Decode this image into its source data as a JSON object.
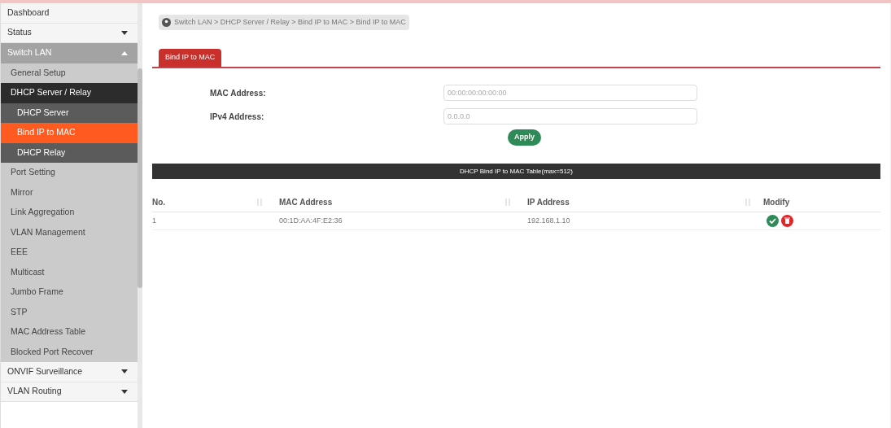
{
  "sidebar": {
    "items": [
      {
        "label": "Dashboard",
        "selected": false
      },
      {
        "label": "Status",
        "selected": false,
        "expanded": false
      },
      {
        "label": "Switch LAN",
        "selected": false,
        "expanded": true,
        "children": [
          {
            "label": "General Setup",
            "selected": false
          },
          {
            "label": "DHCP Server / Relay",
            "selected": false,
            "children": [
              {
                "label": "DHCP Server",
                "selected": false
              },
              {
                "label": "Bind IP to MAC",
                "selected": true
              },
              {
                "label": "DHCP Relay",
                "selected": false
              }
            ]
          },
          {
            "label": "Port Setting",
            "selected": false
          },
          {
            "label": "Mirror",
            "selected": false
          },
          {
            "label": "Link Aggregation",
            "selected": false
          },
          {
            "label": "VLAN Management",
            "selected": false
          },
          {
            "label": "EEE",
            "selected": false
          },
          {
            "label": "Multicast",
            "selected": false
          },
          {
            "label": "Jumbo Frame",
            "selected": false
          },
          {
            "label": "STP",
            "selected": false
          },
          {
            "label": "MAC Address Table",
            "selected": false
          },
          {
            "label": "Blocked Port Recover",
            "selected": false
          }
        ]
      },
      {
        "label": "ONVIF Surveillance",
        "selected": false,
        "expanded": false
      },
      {
        "label": "VLAN Routing",
        "selected": false,
        "expanded": false
      }
    ]
  },
  "breadcrumb": "Switch LAN > DHCP Server / Relay > Bind IP to MAC  > Bind IP to MAC",
  "tabs": [
    {
      "label": "Bind IP to MAC",
      "selected": true
    }
  ],
  "form": {
    "fields": [
      {
        "label": "MAC Address:",
        "placeholder": "00:00:00:00:00:00"
      },
      {
        "label": "IPv4 Address:",
        "placeholder": "0.0.0.0"
      }
    ],
    "apply": "Apply"
  },
  "table": {
    "title": "DHCP Bind IP to MAC Table(max=512)",
    "columns": [
      "No.",
      "MAC Address",
      "IP Address",
      "Modify"
    ],
    "rows": [
      [
        "1",
        "00:1D:AA:4F:E2:36",
        "192.168.1.10"
      ]
    ]
  }
}
